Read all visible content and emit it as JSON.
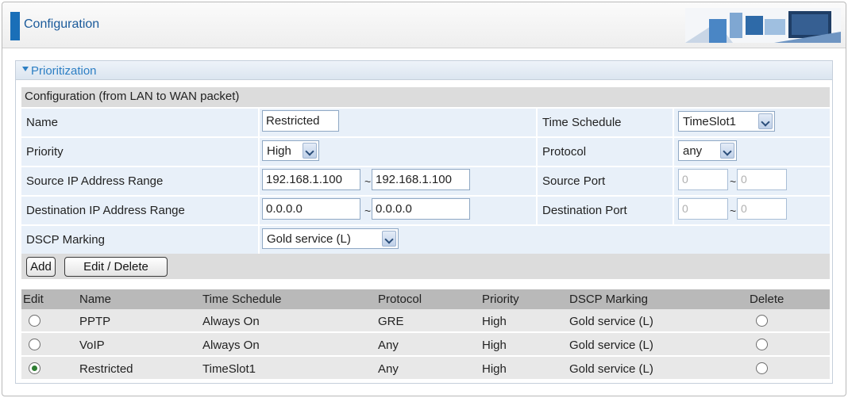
{
  "header": {
    "title": "Configuration"
  },
  "panel": {
    "title": "Prioritization"
  },
  "config_heading": "Configuration (from LAN to WAN packet)",
  "fields": {
    "name": {
      "label": "Name",
      "value": "Restricted"
    },
    "time_schedule": {
      "label": "Time Schedule",
      "value": "TimeSlot1"
    },
    "priority": {
      "label": "Priority",
      "value": "High"
    },
    "protocol": {
      "label": "Protocol",
      "value": "any"
    },
    "source_ip": {
      "label": "Source IP Address Range",
      "from": "192.168.1.100",
      "to": "192.168.1.100"
    },
    "source_port": {
      "label": "Source Port",
      "from": "0",
      "to": "0"
    },
    "dest_ip": {
      "label": "Destination IP Address Range",
      "from": "0.0.0.0",
      "to": "0.0.0.0"
    },
    "dest_port": {
      "label": "Destination Port",
      "from": "0",
      "to": "0"
    },
    "dscp": {
      "label": "DSCP Marking",
      "value": "Gold service (L)"
    },
    "range_sep": "~"
  },
  "buttons": {
    "add": "Add",
    "edit_delete": "Edit / Delete"
  },
  "table": {
    "columns": [
      "Edit",
      "Name",
      "Time Schedule",
      "Protocol",
      "Priority",
      "DSCP Marking",
      "Delete"
    ],
    "rows": [
      {
        "selected": false,
        "name": "PPTP",
        "schedule": "Always On",
        "protocol": "GRE",
        "priority": "High",
        "dscp": "Gold service (L)"
      },
      {
        "selected": false,
        "name": "VoIP",
        "schedule": "Always On",
        "protocol": "Any",
        "priority": "High",
        "dscp": "Gold service (L)"
      },
      {
        "selected": true,
        "name": "Restricted",
        "schedule": "TimeSlot1",
        "protocol": "Any",
        "priority": "High",
        "dscp": "Gold service (L)"
      }
    ]
  },
  "colors": {
    "accent": "#2d7fc4",
    "header_bar": "#1a6fb8",
    "field_bg": "#e8f0f9",
    "radio_selected": "#2e7d32"
  }
}
